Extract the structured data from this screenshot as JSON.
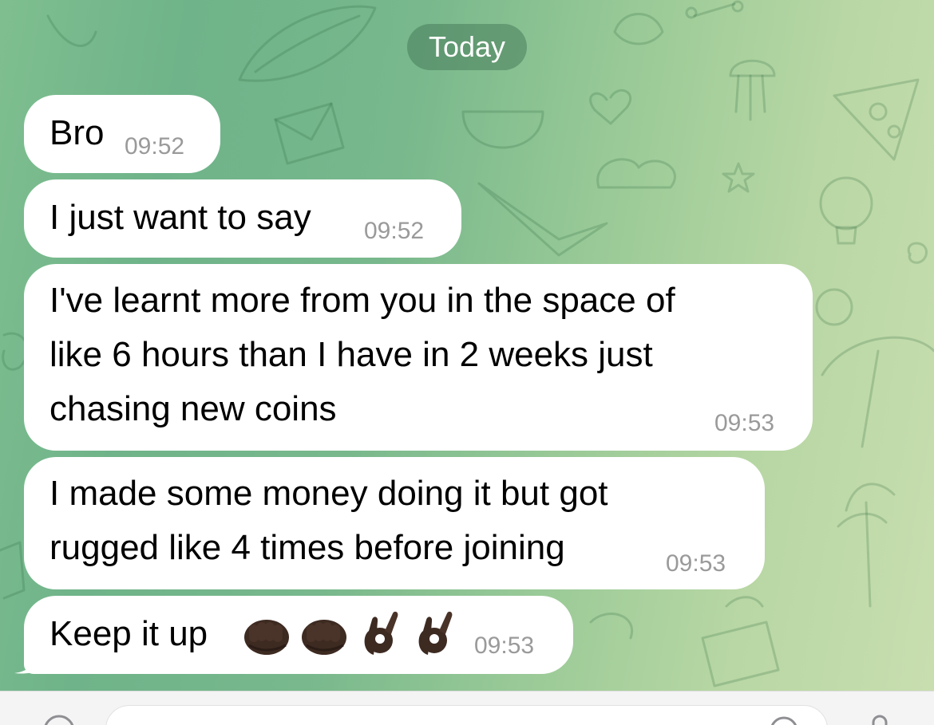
{
  "chat": {
    "date_label": "Today",
    "messages": [
      {
        "text_lines": [
          "Bro"
        ],
        "time": "09:52"
      },
      {
        "text_lines": [
          "I just want to say"
        ],
        "time": "09:52"
      },
      {
        "text_lines": [
          "I've learnt more from you in the space of",
          "like 6 hours than I have in 2 weeks just",
          "chasing new coins"
        ],
        "time": "09:53"
      },
      {
        "text_lines": [
          "I made some money doing it but got",
          "rugged like 4 times before joining"
        ],
        "time": "09:53"
      },
      {
        "text_lines": [
          "Keep it up"
        ],
        "emojis": [
          "oncoming-fist-dark-skin",
          "oncoming-fist-dark-skin",
          "ok-hand-dark-skin",
          "ok-hand-dark-skin"
        ],
        "time": "09:53"
      }
    ]
  },
  "bottom_bar": {
    "icons": [
      "attach-icon",
      "sticker-icon",
      "microphone-icon"
    ]
  },
  "colors": {
    "bubble": "#ffffff",
    "timestamp": "#9a9a9a",
    "date_pill": "#5f8f70",
    "wallpaper_left": "#6fb38a",
    "wallpaper_right": "#c9deb0"
  }
}
